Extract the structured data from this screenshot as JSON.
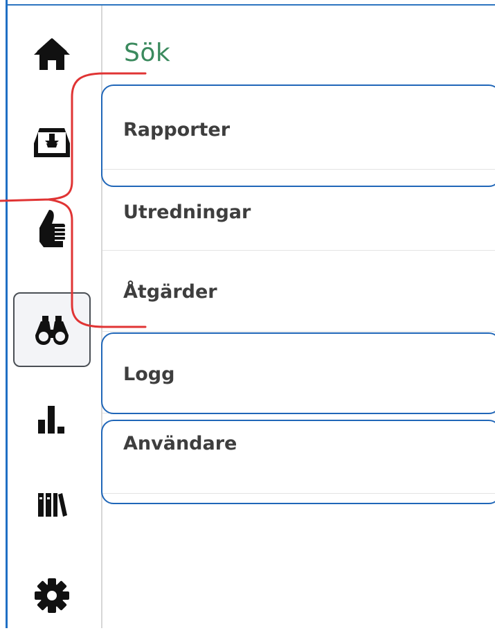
{
  "sidebar": {
    "items": [
      {
        "icon": "home-icon",
        "active": false
      },
      {
        "icon": "inbox-download-icon",
        "active": false
      },
      {
        "icon": "thumbs-up-icon",
        "active": false
      },
      {
        "icon": "binoculars-icon",
        "active": true
      },
      {
        "icon": "bar-chart-icon",
        "active": false
      },
      {
        "icon": "library-books-icon",
        "active": false
      },
      {
        "icon": "gear-icon",
        "active": false
      }
    ]
  },
  "main": {
    "title": "Sök",
    "menu": [
      {
        "label": "Rapporter"
      },
      {
        "label": "Utredningar"
      },
      {
        "label": "Åtgärder"
      },
      {
        "label": "Logg"
      },
      {
        "label": "Användare"
      }
    ]
  },
  "colors": {
    "title": "#3b8a5e",
    "annotation_red": "#e03434",
    "annotation_blue": "#1f66b8"
  }
}
